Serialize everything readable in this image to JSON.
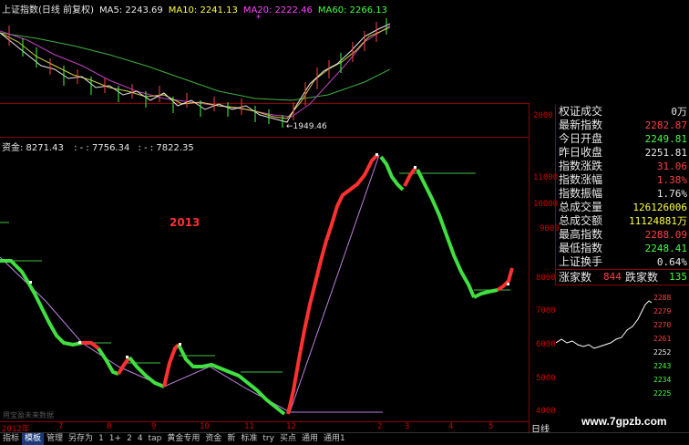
{
  "header": {
    "title": "上证指数(日线 前复权)",
    "ma5": "MA5: 2243.69",
    "ma10": "MA10: 2241.13",
    "ma20": "MA20: 2222.46",
    "ma60": "MA60: 2266.13",
    "marker": "*"
  },
  "top_chart": {
    "low_label": "←1949.46",
    "axis_label": "2000"
  },
  "fund_header": {
    "prefix": "资金: 8271.43",
    "v2": ": -  : 7756.34",
    "v3": ": - : 7822.35"
  },
  "annotation": "2013-",
  "watermark_text": "用宝盈未来数据",
  "right_axis": [
    "11000",
    "10000",
    "9000",
    "8000",
    "7000",
    "6000",
    "5000",
    "4000"
  ],
  "quote": {
    "rows": [
      {
        "k": "权证成交",
        "v": "0万",
        "c": "#e8e8e8"
      },
      {
        "k": "最新指数",
        "v": "2282.87",
        "c": "#ff4040"
      },
      {
        "k": "今日开盘",
        "v": "2249.81",
        "c": "#40ff40"
      },
      {
        "k": "昨日收盘",
        "v": "2251.81",
        "c": "#e8e8e8"
      },
      {
        "k": "指数涨跌",
        "v": "31.06",
        "c": "#ff4040"
      },
      {
        "k": "指数涨幅",
        "v": "1.38%",
        "c": "#ff4040"
      },
      {
        "k": "指数振幅",
        "v": "1.76%",
        "c": "#e8e8e8"
      },
      {
        "k": "总成交量",
        "v": "126126006",
        "c": "#ffff40"
      },
      {
        "k": "总成交额",
        "v": "11124881万",
        "c": "#ffff40"
      },
      {
        "k": "最高指数",
        "v": "2288.09",
        "c": "#ff4040"
      },
      {
        "k": "最低指数",
        "v": "2248.41",
        "c": "#40ff40"
      },
      {
        "k": "上证换手",
        "v": "0.64%",
        "c": "#e8e8e8"
      }
    ],
    "rise_label": "涨家数",
    "rise_val": "844",
    "fall_label": "跌家数",
    "fall_val": "135"
  },
  "mini_ticks": [
    "2288",
    "2279",
    "2270",
    "2261",
    "2252",
    "2243",
    "2234",
    "2225"
  ],
  "dates": [
    "2012年",
    "7",
    "8",
    "9",
    "10",
    "11",
    "12",
    "2",
    "3",
    "4",
    "5"
  ],
  "toolbar": [
    "指标",
    "模板",
    "管理",
    "另存为",
    "1",
    "1+",
    "2",
    "4",
    "tap",
    "黄金专用",
    "资金",
    "新",
    "标准",
    "try",
    "买点",
    "通用",
    "通用1"
  ],
  "toolbar_active": 1,
  "period_label": "日线",
  "site": "www.7gpzb.com"
}
